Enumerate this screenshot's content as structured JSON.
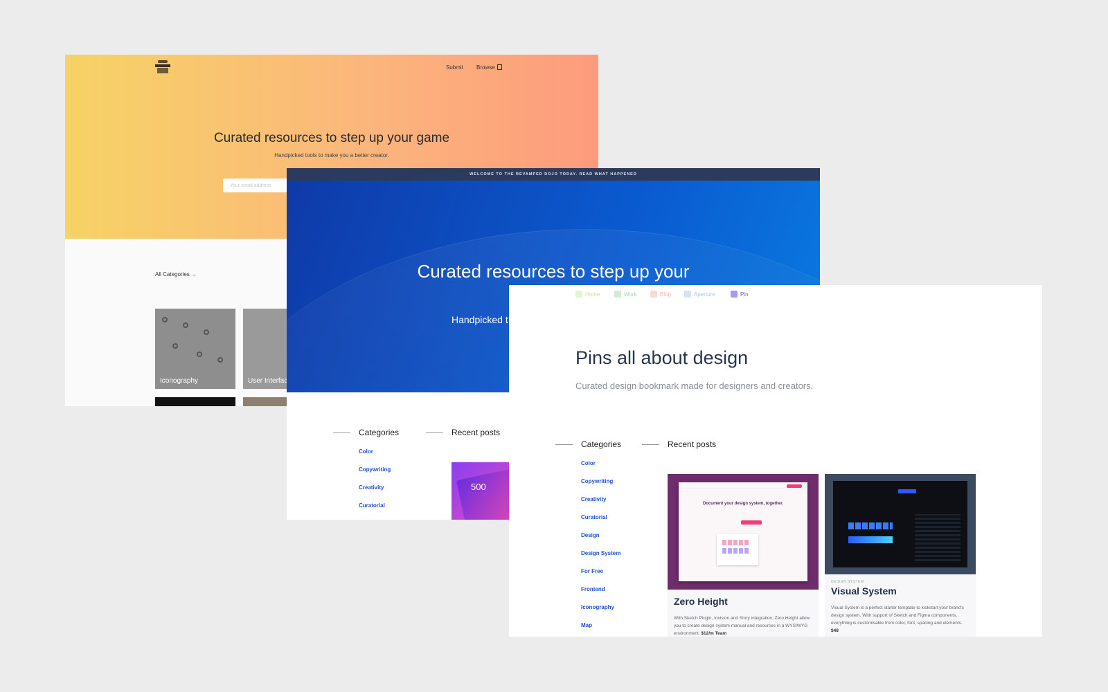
{
  "card1": {
    "nav": {
      "submit": "Submit",
      "browse": "Browse"
    },
    "hero": {
      "title": "Curated resources to step up your game",
      "subtitle": "Handpicked tools to make you a better creator.",
      "email_placeholder": "Your email address"
    },
    "all_categories": "All Categories →",
    "tiles": [
      "Iconography",
      "User Interface"
    ],
    "colors": {
      "gradient_start": "#f6d365",
      "gradient_end": "#fd9b7d"
    }
  },
  "card2": {
    "banner": "WELCOME TO THE REVAMPED DOJO TODAY. READ WHAT HAPPENED",
    "hero": {
      "title": "Curated resources to step up your game",
      "subtitle": "Handpicked t"
    },
    "categories_heading": "Categories",
    "recent_heading": "Recent posts",
    "categories": [
      "Color",
      "Copywriting",
      "Creativity",
      "Curatorial"
    ],
    "post_number": "500",
    "colors": {
      "hero_start": "#0f3aa8",
      "hero_end": "#0a7be0",
      "link": "#1d4fd8"
    }
  },
  "card3": {
    "nav": [
      {
        "label": "Home",
        "color": "#c8e6a0",
        "icon": "home-icon"
      },
      {
        "label": "Work",
        "color": "#9fe0a8",
        "icon": "work-icon"
      },
      {
        "label": "Blog",
        "color": "#f6b5a8",
        "icon": "blog-icon"
      },
      {
        "label": "Aperture",
        "color": "#a8c6f0",
        "icon": "aperture-icon"
      },
      {
        "label": "Pin",
        "color": "#6b5ce7",
        "icon": "pin-icon"
      }
    ],
    "title": "Pins all about design",
    "subtitle": "Curated design bookmark made for designers and creators.",
    "categories_heading": "Categories",
    "recent_heading": "Recent posts",
    "categories": [
      "Color",
      "Copywriting",
      "Creativity",
      "Curatorial",
      "Design",
      "Design System",
      "For Free",
      "Frontend",
      "Iconography",
      "Map"
    ],
    "posts": [
      {
        "title": "Zero Height",
        "screen_heading": "Document your design system, together.",
        "description": "With Sketch Plugin, Invision and Story integration, Zero Height allow you to create design system manual and resources in a WYSIWYG environment.",
        "price": "$12/m Team"
      },
      {
        "tag": "DESIGN SYSTEM",
        "title": "Visual System",
        "description": "Visual System is a perfect starter template to kickstart your brand's design system. With support of Sketch and Figma components, everything is customisable from color, font, spacing and elements.",
        "price": "$48"
      }
    ]
  }
}
